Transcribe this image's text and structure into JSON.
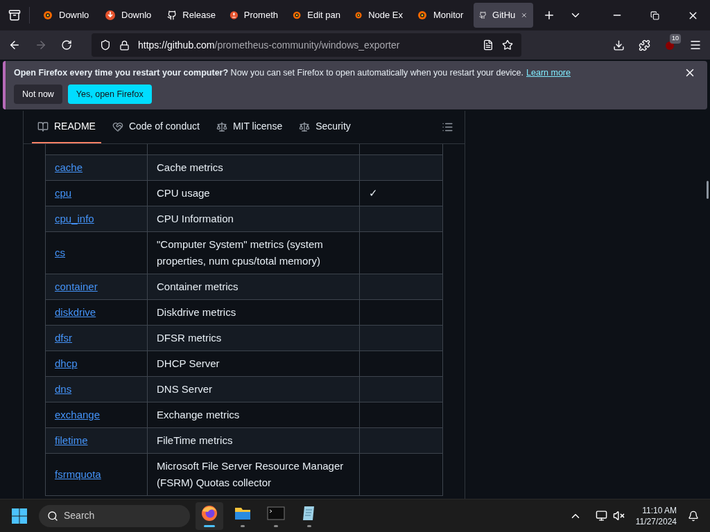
{
  "browser": {
    "tabs": [
      {
        "kind": "grafana",
        "label": "Downlo",
        "selected": false
      },
      {
        "kind": "download",
        "label": "Downlo",
        "selected": false
      },
      {
        "kind": "github",
        "label": "Release",
        "selected": false
      },
      {
        "kind": "prometheus",
        "label": "Prometh",
        "selected": false
      },
      {
        "kind": "grafana",
        "label": "Edit pan",
        "selected": false
      },
      {
        "kind": "grafana",
        "label": "Node Ex",
        "selected": false
      },
      {
        "kind": "grafana",
        "label": "Monitor",
        "selected": false
      },
      {
        "kind": "github",
        "label": "GitHu",
        "selected": true
      }
    ],
    "url_host": "https://github.com",
    "url_path": "/prometheus-community/windows_exporter",
    "extensions_badge": "10"
  },
  "notification": {
    "title": "Open Firefox every time you restart your computer?",
    "message": "Now you can set Firefox to open automatically when you restart your device.",
    "link": "Learn more",
    "buttons": [
      {
        "label": "Not now",
        "kind": "secondary"
      },
      {
        "label": "Yes, open Firefox",
        "kind": "primary"
      }
    ]
  },
  "readme_tabs": [
    {
      "label": "README",
      "selected": true
    },
    {
      "label": "Code of conduct",
      "selected": false
    },
    {
      "label": "MIT license",
      "selected": false
    },
    {
      "label": "Security",
      "selected": false
    }
  ],
  "table": {
    "rows": [
      {
        "name": "cache",
        "description": "Cache metrics"
      },
      {
        "name": "cpu",
        "description": "CPU usage",
        "mark": "✓"
      },
      {
        "name": "cpu_info",
        "description": "CPU Information"
      },
      {
        "name": "cs",
        "description": "\"Computer System\" metrics (system properties, num cpus/total memory)"
      },
      {
        "name": "container",
        "description": "Container metrics"
      },
      {
        "name": "diskdrive",
        "description": "Diskdrive metrics"
      },
      {
        "name": "dfsr",
        "description": "DFSR metrics"
      },
      {
        "name": "dhcp",
        "description": "DHCP Server"
      },
      {
        "name": "dns",
        "description": "DNS Server"
      },
      {
        "name": "exchange",
        "description": "Exchange metrics"
      },
      {
        "name": "filetime",
        "description": "FileTime metrics"
      },
      {
        "name": "fsrmquota",
        "description": "Microsoft File Server Resource Manager (FSRM) Quotas collector"
      }
    ]
  },
  "taskbar": {
    "search_placeholder": "Search",
    "apps": [
      {
        "kind": "firefox",
        "selected": true
      },
      {
        "kind": "folder",
        "selected": false
      },
      {
        "kind": "terminal",
        "selected": false
      },
      {
        "kind": "notepad",
        "selected": false
      }
    ],
    "time": "11:10 AM",
    "date": "11/27/2024"
  }
}
